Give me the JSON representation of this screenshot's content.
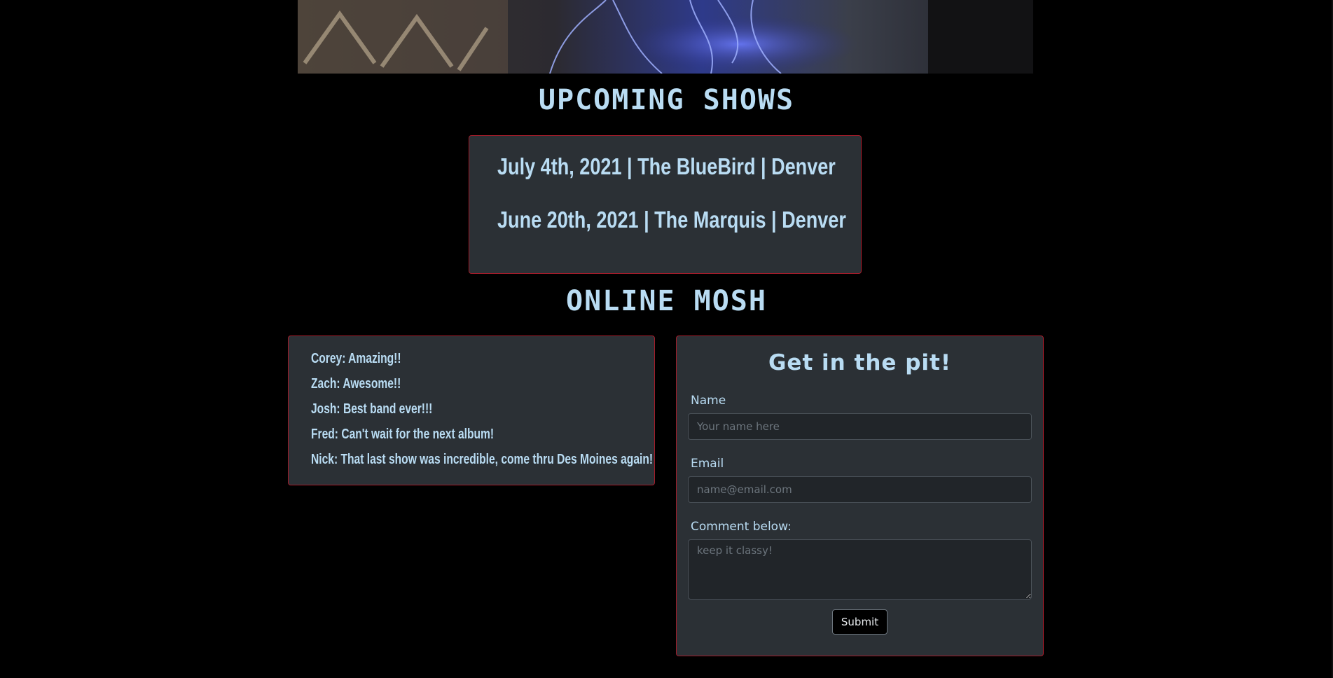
{
  "hero": {
    "alt": "concert stage photo"
  },
  "shows": {
    "title": "UPCOMING SHOWS",
    "items": [
      "July 4th, 2021 | The BlueBird | Denver",
      "June 20th, 2021 | The Marquis | Denver"
    ]
  },
  "mosh": {
    "title": "ONLINE MOSH",
    "comments": [
      "Corey: Amazing!!",
      "Zach: Awesome!!",
      "Josh: Best band ever!!!",
      "Fred: Can't wait for the next album!",
      "Nick: That last show was incredible, come thru Des Moines again!"
    ]
  },
  "form": {
    "heading": "Get in the pit!",
    "name_label": "Name",
    "name_placeholder": "Your name here",
    "email_label": "Email",
    "email_placeholder": "name@email.com",
    "comment_label": "Comment below:",
    "comment_placeholder": "keep it classy!",
    "submit_label": "Submit"
  },
  "colors": {
    "background": "#000000",
    "card": "#2b3035",
    "card_border": "#a31c2a",
    "text": "#b9dcf3"
  }
}
